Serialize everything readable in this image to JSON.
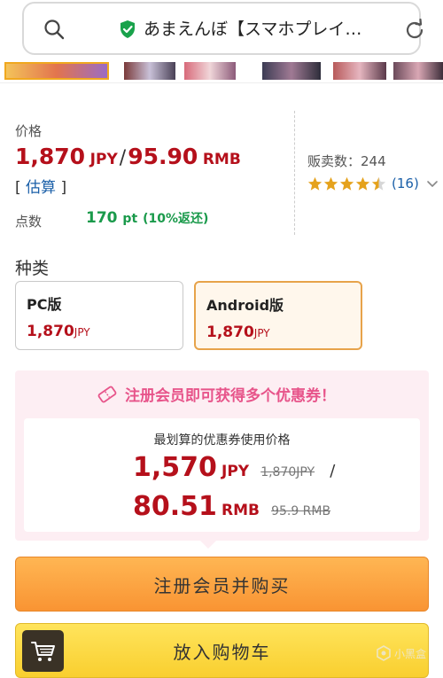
{
  "browser": {
    "url_text": "あまえんぼ【スマホプレイ…",
    "icons": {
      "search": "search-icon",
      "secure": "shield-check-icon",
      "reload": "reload-icon"
    }
  },
  "price": {
    "label": "价格",
    "jpy_value": "1,870",
    "jpy_unit": "JPY",
    "separator": "/",
    "rmb_value": "95.90",
    "rmb_unit": "RMB",
    "estimate_open": "[",
    "estimate_link": "估算",
    "estimate_close": "]",
    "points_label": "点数",
    "points_value": "170",
    "points_unit": "pt",
    "points_note": "(10%返还)"
  },
  "sales": {
    "label": "贩卖数：244",
    "rating_stars": 4.5,
    "rating_count": "(16)"
  },
  "variants": {
    "label": "种类",
    "items": [
      {
        "name": "PC版",
        "price": "1,870",
        "unit": "JPY",
        "selected": false
      },
      {
        "name": "Android版",
        "price": "1,870",
        "unit": "JPY",
        "selected": true
      }
    ]
  },
  "coupon": {
    "headline": "注册会员即可获得多个优惠券！",
    "best_label": "最划算的优惠券使用价格",
    "jpy_value": "1,570",
    "jpy_unit": "JPY",
    "jpy_original": "1,870JPY",
    "slash": "/",
    "rmb_value": "80.51",
    "rmb_unit": "RMB",
    "rmb_original": "95.9 RMB"
  },
  "actions": {
    "register_label": "注册会员并购买",
    "cart_label": "放入购物车"
  },
  "watermark": {
    "text": "小黑盒"
  },
  "colors": {
    "price_red": "#b5101b",
    "points_green": "#1a9a4b",
    "link_blue": "#1a5fa8",
    "accent_orange": "#f99433",
    "accent_yellow": "#f9cf2f",
    "coupon_pink": "#e7548a",
    "star_gold": "#e5a21c"
  }
}
